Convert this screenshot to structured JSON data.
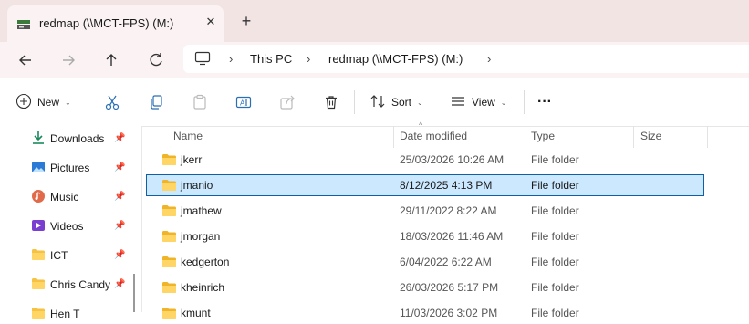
{
  "tab": {
    "title": "redmap (\\\\MCT-FPS) (M:)",
    "close": "✕",
    "new_tab": "+"
  },
  "address": {
    "crumbs": [
      "This PC",
      "redmap (\\\\MCT-FPS) (M:)"
    ],
    "separator": "›"
  },
  "toolbar": {
    "new_label": "New",
    "sort_label": "Sort",
    "view_label": "View",
    "more_label": "···",
    "chevron": "⌄"
  },
  "sidebar": {
    "items": [
      {
        "label": "Downloads",
        "icon": "download-icon"
      },
      {
        "label": "Pictures",
        "icon": "pictures-icon"
      },
      {
        "label": "Music",
        "icon": "music-icon"
      },
      {
        "label": "Videos",
        "icon": "videos-icon"
      },
      {
        "label": "ICT",
        "icon": "folder-icon"
      },
      {
        "label": "Chris Candy",
        "icon": "folder-icon"
      },
      {
        "label": "Hen T",
        "icon": "folder-icon"
      }
    ],
    "pin": "📌"
  },
  "columns": {
    "name": "Name",
    "date": "Date modified",
    "type": "Type",
    "size": "Size",
    "sort_indicator": "^"
  },
  "files": [
    {
      "name": "jkerr",
      "date": "25/03/2026 10:26 AM",
      "type": "File folder"
    },
    {
      "name": "jmanio",
      "date": "8/12/2025 4:13 PM",
      "type": "File folder",
      "selected": true
    },
    {
      "name": "jmathew",
      "date": "29/11/2022 8:22 AM",
      "type": "File folder"
    },
    {
      "name": "jmorgan",
      "date": "18/03/2026 11:46 AM",
      "type": "File folder"
    },
    {
      "name": "kedgerton",
      "date": "6/04/2022 6:22 AM",
      "type": "File folder"
    },
    {
      "name": "kheinrich",
      "date": "26/03/2026 5:17 PM",
      "type": "File folder"
    },
    {
      "name": "kmunt",
      "date": "11/03/2026 3:02 PM",
      "type": "File folder"
    }
  ],
  "colors": {
    "accent": "#0f5fa8",
    "selection": "#cce8ff",
    "folder": "#f5c242",
    "titlebar": "#f3e4e4"
  }
}
